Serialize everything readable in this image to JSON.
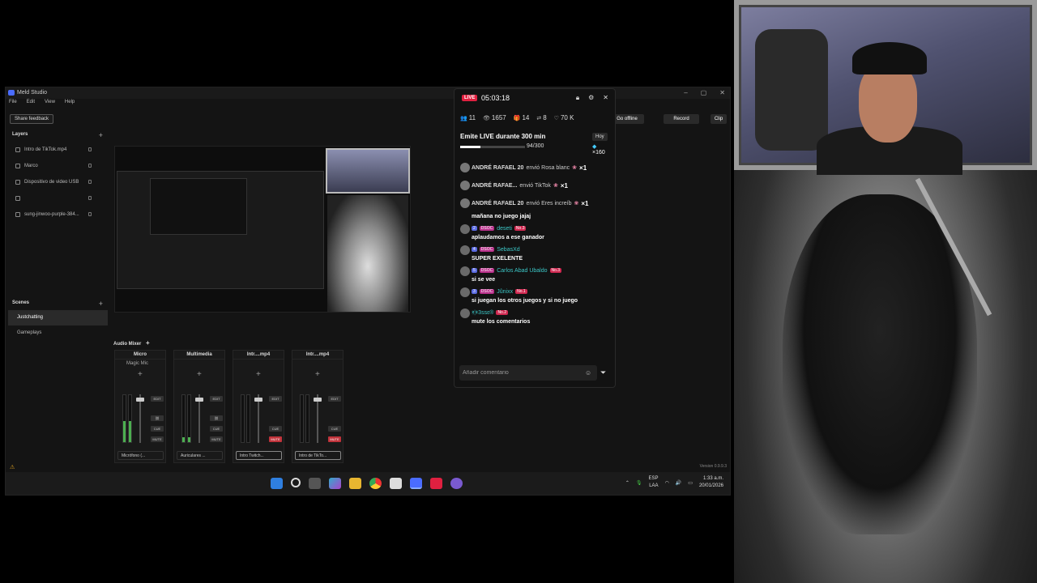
{
  "meld": {
    "title": "Meld Studio",
    "menu": [
      "File",
      "Edit",
      "View",
      "Help"
    ],
    "feedback_label": "Share feedback",
    "go_offline_label": "Go offline",
    "record_label": "Record",
    "clip_label": "Clip",
    "layers_title": "Layers",
    "layers": [
      {
        "label": "Intro de TikTok.mp4"
      },
      {
        "label": "Marco"
      },
      {
        "label": "Dispositivo de video USB"
      },
      {
        "label": ""
      },
      {
        "label": "sung-jinwoo-purple-384..."
      }
    ],
    "scenes_title": "Scenes",
    "scenes": [
      {
        "label": "Justchatting",
        "active": true
      },
      {
        "label": "Gameplays",
        "active": false
      }
    ],
    "mixer_title": "Audio Mixer",
    "channels": [
      {
        "name": "Micro",
        "filter": "Magic Mic",
        "db": "-6.6",
        "gain": "0.0",
        "device": "Micrófono (...",
        "muted": false,
        "level": 0.45
      },
      {
        "name": "Multimedia",
        "filter": "",
        "db": "-9.1",
        "gain": "0.0",
        "device": "Auriculares ...",
        "muted": false,
        "level": 0.1
      },
      {
        "name": "Intr....mp4",
        "filter": "",
        "db": "",
        "gain": "0.0",
        "device": "Intro Twitch...",
        "muted": true,
        "level": 0
      },
      {
        "name": "Intr....mp4",
        "filter": "",
        "db": "",
        "gain": "0.0",
        "device": "Intro de TikTo...",
        "muted": true,
        "level": 0
      }
    ],
    "edit_label": "EDIT",
    "cue_label": "CUE",
    "mute_label": "MUTE",
    "version": "Version 0.9.9.3"
  },
  "taskbar": {
    "lang_top": "ESP",
    "lang_bottom": "LAA",
    "time": "1:33 a.m.",
    "date": "20/01/2026"
  },
  "live": {
    "badge": "LIVE",
    "timer": "05:03:18",
    "stats": [
      {
        "icon": "people-icon",
        "glyph": "👥",
        "value": "11"
      },
      {
        "icon": "eye-icon",
        "glyph": "👁",
        "value": "1657"
      },
      {
        "icon": "gift-icon",
        "glyph": "🎁",
        "value": "14"
      },
      {
        "icon": "share-icon",
        "glyph": "⇄",
        "value": "8"
      },
      {
        "icon": "heart-icon",
        "glyph": "♡",
        "value": "70 K"
      }
    ],
    "goal_title": "Emite LIVE durante 300 min",
    "goal_count": "94/300",
    "goal_progress": 0.313,
    "goal_gift": "×160",
    "hoy_label": "Hoy",
    "gifts": [
      {
        "user": "ANDRÉ RAFAEL 20",
        "text": "envió Rosa blanc",
        "mult": "×1"
      },
      {
        "user": "ANDRÉ RAFAE...",
        "text": "envió TikTok",
        "mult": "×1"
      },
      {
        "user": "ANDRÉ RAFAEL 20",
        "text": "envió Eres increíb",
        "mult": "×1"
      }
    ],
    "messages": [
      {
        "user": "",
        "level": "",
        "fan": "",
        "rank": "",
        "text": "mañana no juego jajaj"
      },
      {
        "user": "deseti",
        "level": "2",
        "fan": "DSOC",
        "rank": "No.3",
        "text": "aplaudamos a ese ganador"
      },
      {
        "user": "SebasXd",
        "level": "4",
        "fan": "DSOC",
        "rank": "",
        "text": "SUPER EXELENTE"
      },
      {
        "user": "Carlos Abad Ubaldo",
        "level": "5",
        "fan": "DSOC",
        "rank": "No.3",
        "text": "si se vee"
      },
      {
        "user": "Jûnixx",
        "level": "3",
        "fan": "DSOC",
        "rank": "No.1",
        "text": "si juegan los otros juegos y si no juego"
      },
      {
        "user": "×҉×3ssɛ®",
        "level": "",
        "fan": "",
        "rank": "No.2",
        "text": "mute los comentarios"
      }
    ],
    "comment_placeholder": "Añadir comentario"
  }
}
